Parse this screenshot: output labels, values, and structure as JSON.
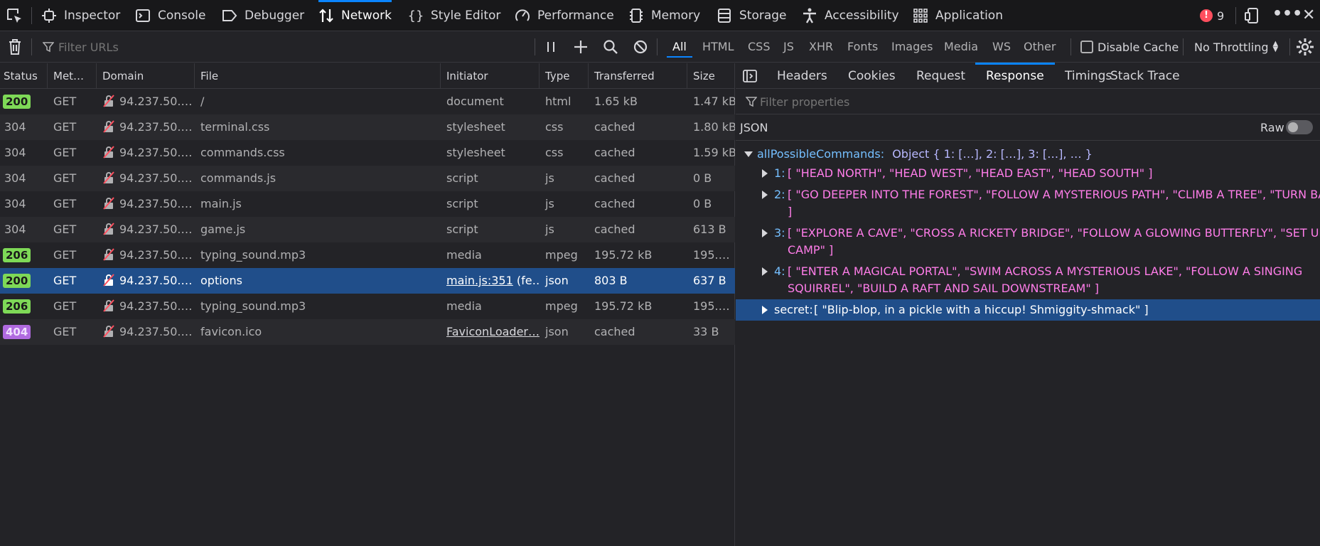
{
  "toolbar": {
    "tabs": [
      {
        "label": "Inspector",
        "icon": "inspector-icon"
      },
      {
        "label": "Console",
        "icon": "console-icon"
      },
      {
        "label": "Debugger",
        "icon": "debugger-icon"
      },
      {
        "label": "Network",
        "icon": "network-icon",
        "active": true
      },
      {
        "label": "Style Editor",
        "icon": "style-editor-icon"
      },
      {
        "label": "Performance",
        "icon": "performance-icon"
      },
      {
        "label": "Memory",
        "icon": "memory-icon"
      },
      {
        "label": "Storage",
        "icon": "storage-icon"
      },
      {
        "label": "Accessibility",
        "icon": "accessibility-icon"
      },
      {
        "label": "Application",
        "icon": "application-icon"
      }
    ],
    "error_count": "9"
  },
  "filterbar": {
    "placeholder": "Filter URLs",
    "types": [
      "All",
      "HTML",
      "CSS",
      "JS",
      "XHR",
      "Fonts",
      "Images",
      "Media",
      "WS",
      "Other"
    ],
    "active_type": "All",
    "disable_cache_label": "Disable Cache",
    "throttling_label": "No Throttling"
  },
  "table": {
    "columns": [
      "Status",
      "Met…",
      "Domain",
      "File",
      "Initiator",
      "Type",
      "Transferred",
      "Size"
    ],
    "rows": [
      {
        "status": "200",
        "method": "GET",
        "domain": "94.237.50.…",
        "file": "/",
        "initiator": "document",
        "type": "html",
        "transferred": "1.65 kB",
        "size": "1.47 kB"
      },
      {
        "status": "304",
        "method": "GET",
        "domain": "94.237.50.…",
        "file": "terminal.css",
        "initiator": "stylesheet",
        "type": "css",
        "transferred": "cached",
        "size": "1.80 kB"
      },
      {
        "status": "304",
        "method": "GET",
        "domain": "94.237.50.…",
        "file": "commands.css",
        "initiator": "stylesheet",
        "type": "css",
        "transferred": "cached",
        "size": "1.59 kB"
      },
      {
        "status": "304",
        "method": "GET",
        "domain": "94.237.50.…",
        "file": "commands.js",
        "initiator": "script",
        "type": "js",
        "transferred": "cached",
        "size": "0 B"
      },
      {
        "status": "304",
        "method": "GET",
        "domain": "94.237.50.…",
        "file": "main.js",
        "initiator": "script",
        "type": "js",
        "transferred": "cached",
        "size": "0 B"
      },
      {
        "status": "304",
        "method": "GET",
        "domain": "94.237.50.…",
        "file": "game.js",
        "initiator": "script",
        "type": "js",
        "transferred": "cached",
        "size": "613 B"
      },
      {
        "status": "206",
        "method": "GET",
        "domain": "94.237.50.…",
        "file": "typing_sound.mp3",
        "initiator": "media",
        "type": "mpeg",
        "transferred": "195.72 kB",
        "size": "195.…"
      },
      {
        "status": "200",
        "method": "GET",
        "domain": "94.237.50.…",
        "file": "options",
        "initiator_link": "main.js:351",
        "initiator_extra": " (fe…",
        "type": "json",
        "transferred": "803 B",
        "size": "637 B",
        "selected": true
      },
      {
        "status": "206",
        "method": "GET",
        "domain": "94.237.50.…",
        "file": "typing_sound.mp3",
        "initiator": "media",
        "type": "mpeg",
        "transferred": "195.72 kB",
        "size": "195.…"
      },
      {
        "status": "404",
        "method": "GET",
        "domain": "94.237.50.…",
        "file": "favicon.ico",
        "initiator_link": "FaviconLoader…",
        "initiator_extra": "",
        "type": "json",
        "transferred": "cached",
        "size": "33 B"
      }
    ]
  },
  "sidepanel": {
    "tabs": [
      "Headers",
      "Cookies",
      "Request",
      "Response",
      "Timings",
      "Stack Trace"
    ],
    "active_tab": "Response",
    "filter_placeholder": "Filter properties",
    "json_label": "JSON",
    "raw_label": "Raw",
    "root_key": "allPossibleCommands:",
    "root_summary": "Object { 1: […], 2: […], 3: […], … }",
    "entries": [
      {
        "key": "1:",
        "lines": [
          "[ \"HEAD NORTH\", \"HEAD WEST\", \"HEAD EAST\", \"HEAD SOUTH\" ]"
        ]
      },
      {
        "key": "2:",
        "lines": [
          "[ \"GO DEEPER INTO THE FOREST\", \"FOLLOW A MYSTERIOUS PATH\", \"CLIMB A TREE\", \"TURN BACK\"",
          "]"
        ]
      },
      {
        "key": "3:",
        "lines": [
          "[ \"EXPLORE A CAVE\", \"CROSS A RICKETY BRIDGE\", \"FOLLOW A GLOWING BUTTERFLY\", \"SET UP",
          "CAMP\" ]"
        ]
      },
      {
        "key": "4:",
        "lines": [
          "[ \"ENTER A MAGICAL PORTAL\", \"SWIM ACROSS A MYSTERIOUS LAKE\", \"FOLLOW A SINGING",
          "SQUIRREL\", \"BUILD A RAFT AND SAIL DOWNSTREAM\" ]"
        ]
      },
      {
        "key": "secret:",
        "lines": [
          "[ \"Blip-blop, in a pickle with a hiccup! Shmiggity-shmack\" ]"
        ],
        "selected": true
      }
    ]
  }
}
